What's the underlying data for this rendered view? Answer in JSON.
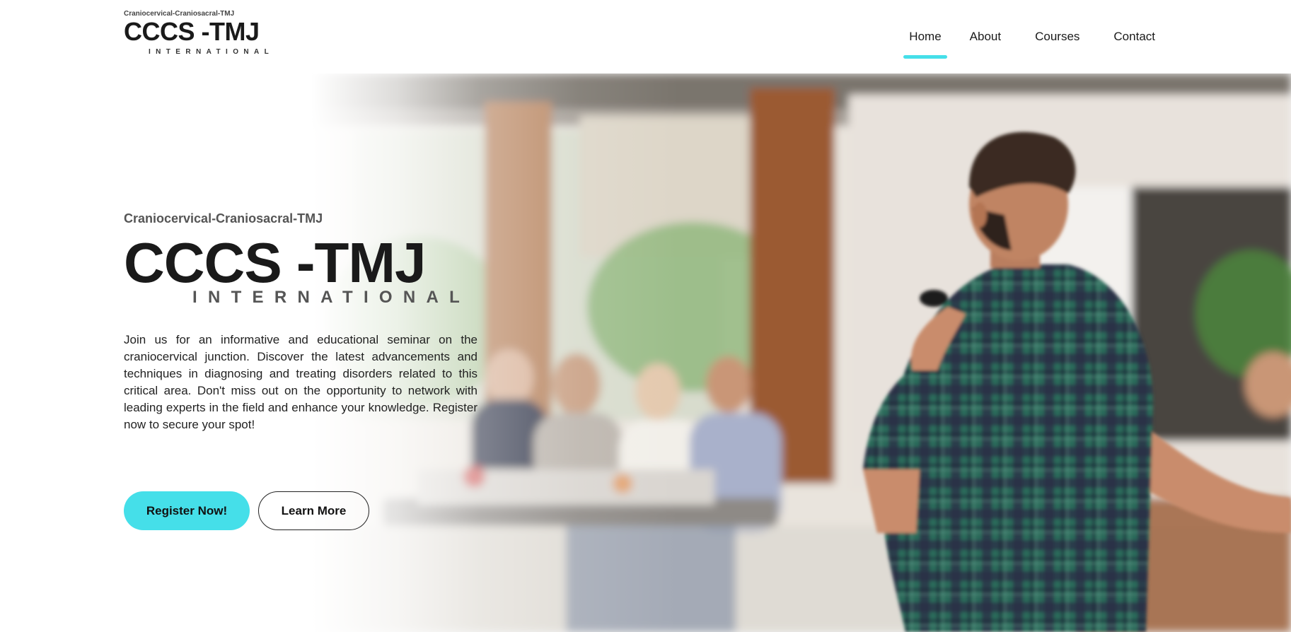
{
  "header": {
    "logo": {
      "small": "Craniocervical-Craniosacral-TMJ",
      "main": "CCCS -TMJ",
      "sub": "INTERNATIONAL"
    },
    "nav": [
      {
        "label": "Home",
        "active": true
      },
      {
        "label": "About",
        "active": false
      },
      {
        "label": "Courses",
        "active": false
      },
      {
        "label": "Contact",
        "active": false
      }
    ]
  },
  "hero": {
    "subtitle": "Craniocervical-Craniosacral-TMJ",
    "title": "CCCS -TMJ",
    "sub": "INTERNATIONAL",
    "description": "Join us for an informative and educational seminar on the craniocervical junction. Discover the latest advancements and techniques in diagnosing and treating disorders related to this critical area. Don't miss out on the opportunity to network with leading experts in the field and enhance your knowledge. Register now to secure your spot!",
    "buttons": {
      "register": "Register Now!",
      "learn": "Learn More"
    }
  },
  "colors": {
    "accent": "#45dfe9",
    "text": "#1a1a1a",
    "muted": "#555555"
  },
  "icons": {
    "background_photo": "seminar-speaker-photo"
  }
}
